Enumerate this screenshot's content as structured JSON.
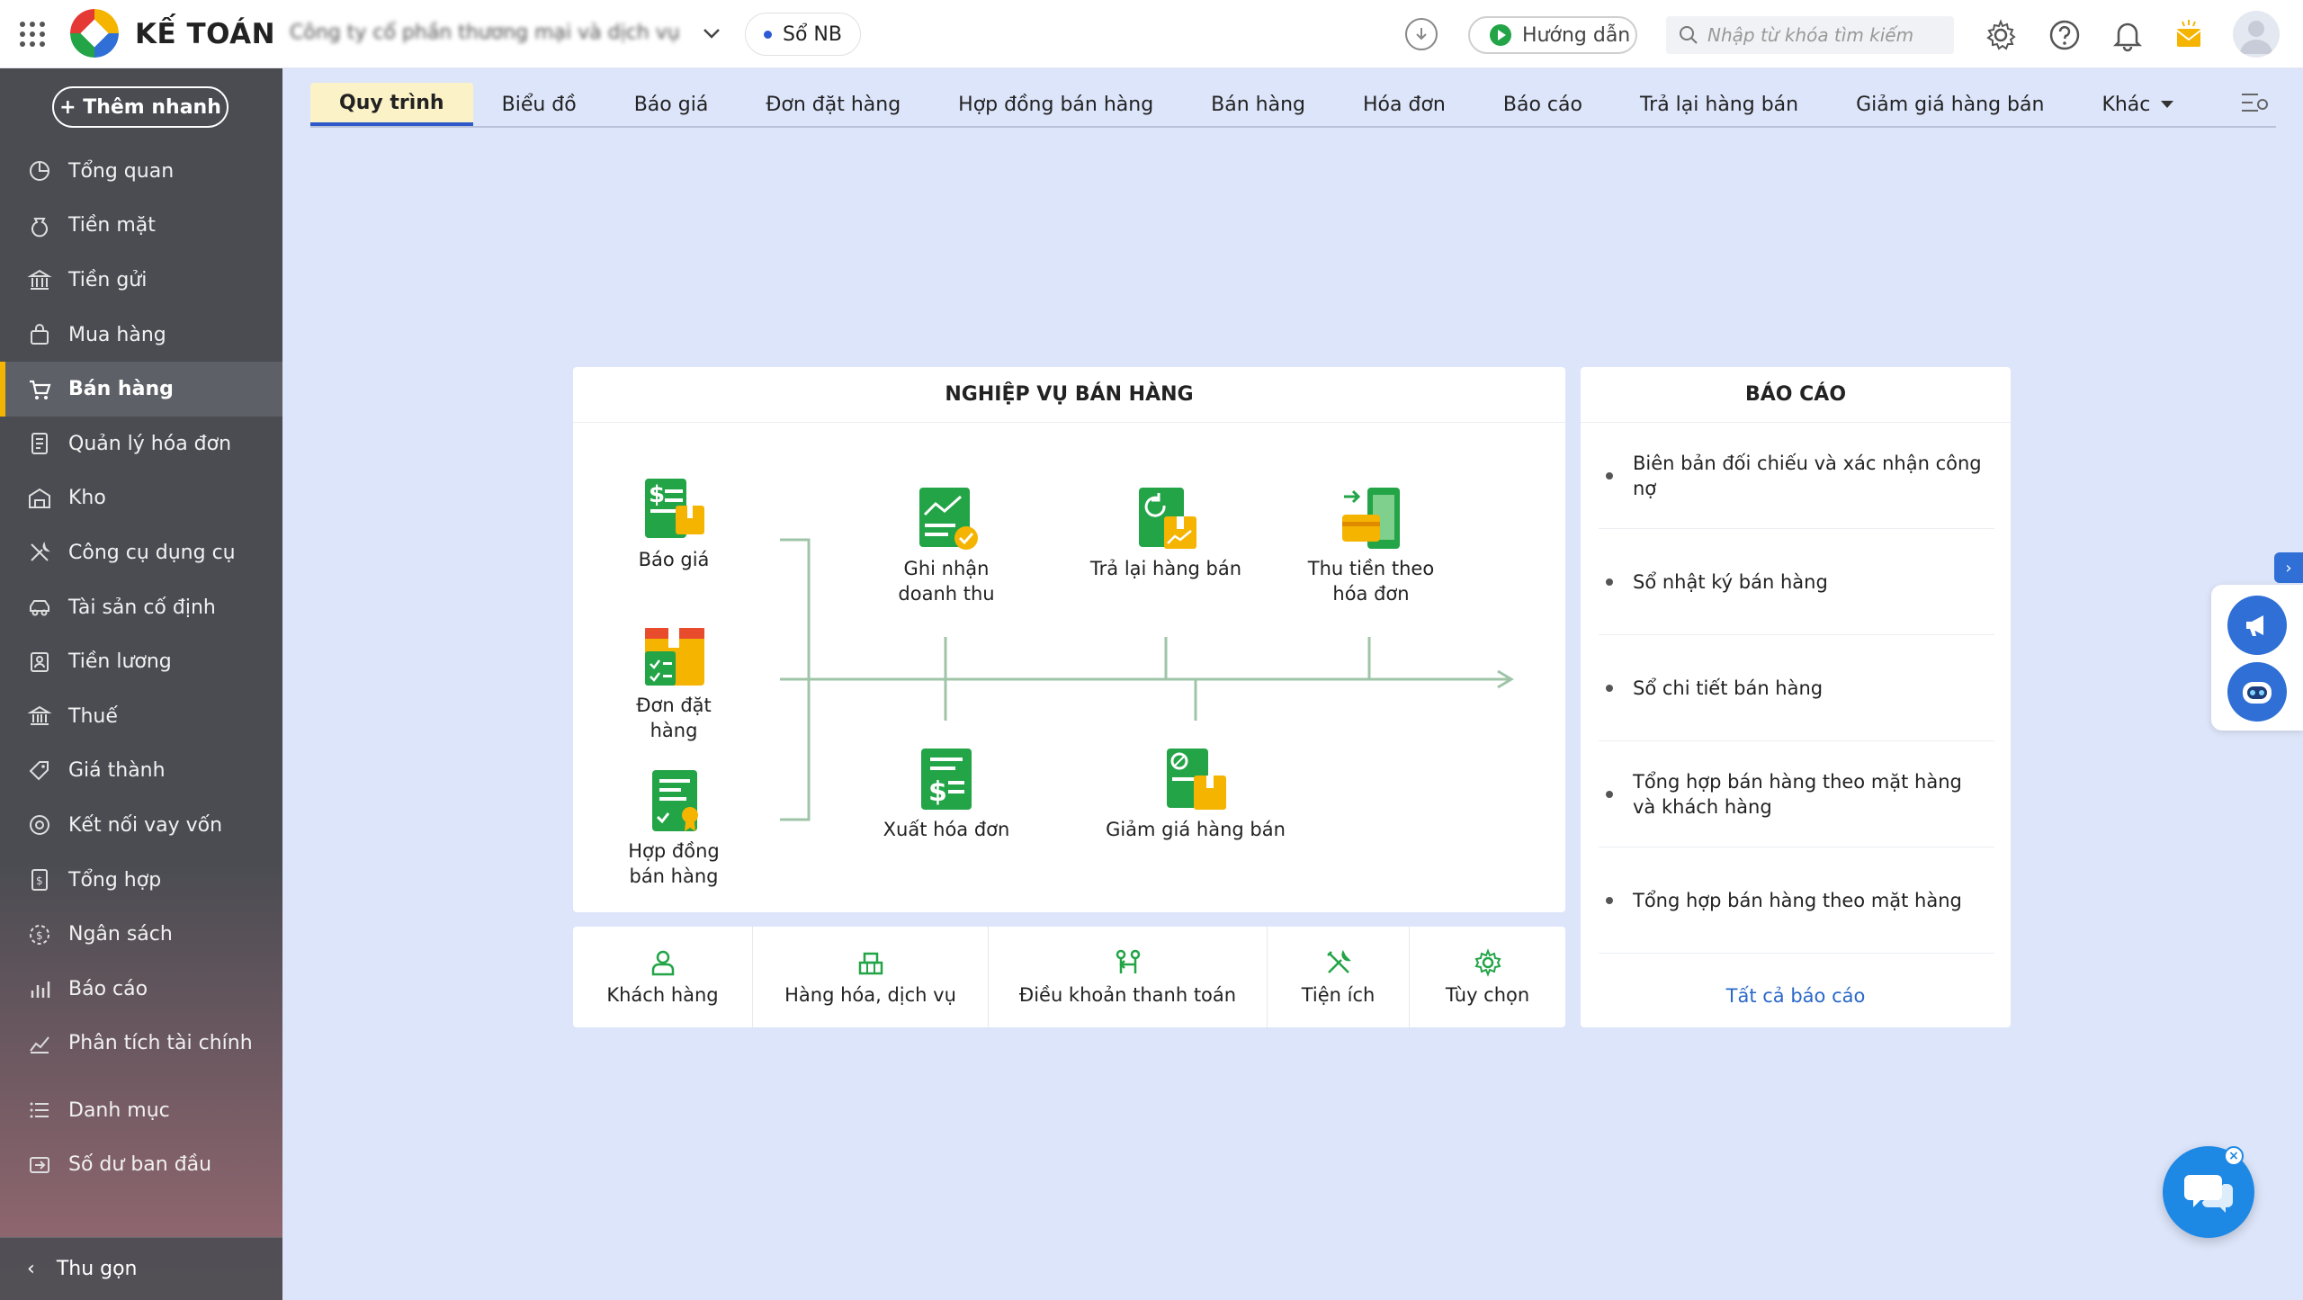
{
  "header": {
    "app_name": "KẾ TOÁN",
    "company_name": "Công ty cổ phần thương mại và dịch vụ",
    "book_label": "Sổ NB",
    "guide_label": "Hướng dẫn",
    "search_placeholder": "Nhập từ khóa tìm kiếm"
  },
  "sidebar": {
    "quick_add": "+ Thêm nhanh",
    "items": [
      {
        "label": "Tổng quan",
        "icon": "pie-chart-icon"
      },
      {
        "label": "Tiền mặt",
        "icon": "money-bag-icon"
      },
      {
        "label": "Tiền gửi",
        "icon": "bank-icon"
      },
      {
        "label": "Mua hàng",
        "icon": "shopping-bag-icon"
      },
      {
        "label": "Bán hàng",
        "icon": "cart-icon",
        "active": true
      },
      {
        "label": "Quản lý hóa đơn",
        "icon": "invoice-icon"
      },
      {
        "label": "Kho",
        "icon": "warehouse-icon"
      },
      {
        "label": "Công cụ dụng cụ",
        "icon": "tools-icon"
      },
      {
        "label": "Tài sản cố định",
        "icon": "car-icon"
      },
      {
        "label": "Tiền lương",
        "icon": "payroll-icon"
      },
      {
        "label": "Thuế",
        "icon": "tax-icon"
      },
      {
        "label": "Giá thành",
        "icon": "price-tag-icon"
      },
      {
        "label": "Kết nối vay vốn",
        "icon": "loan-icon"
      },
      {
        "label": "Tổng hợp",
        "icon": "summary-icon"
      },
      {
        "label": "Ngân sách",
        "icon": "budget-icon"
      },
      {
        "label": "Báo cáo",
        "icon": "report-icon"
      },
      {
        "label": "Phân tích tài chính",
        "icon": "analysis-icon"
      }
    ],
    "items2": [
      {
        "label": "Danh mục",
        "icon": "list-icon"
      },
      {
        "label": "Số dư ban đầu",
        "icon": "opening-balance-icon"
      }
    ],
    "collapse_label": "Thu gọn"
  },
  "tabs": [
    {
      "label": "Quy trình",
      "active": true
    },
    {
      "label": "Biểu đồ"
    },
    {
      "label": "Báo giá"
    },
    {
      "label": "Đơn đặt hàng"
    },
    {
      "label": "Hợp đồng bán hàng"
    },
    {
      "label": "Bán hàng"
    },
    {
      "label": "Hóa đơn"
    },
    {
      "label": "Báo cáo"
    },
    {
      "label": "Trả lại hàng bán"
    },
    {
      "label": "Giảm giá hàng bán"
    },
    {
      "label": "Khác",
      "dropdown": true
    }
  ],
  "process": {
    "title": "NGHIỆP VỤ BÁN HÀNG",
    "nodes": {
      "quote": "Báo giá",
      "order": "Đơn đặt hàng",
      "contract": "Hợp đồng bán hàng",
      "revenue": "Ghi nhận doanh thu",
      "returns": "Trả lại hàng bán",
      "collect": "Thu tiền theo hóa đơn",
      "invoice": "Xuất hóa đơn",
      "discount": "Giảm giá hàng bán"
    }
  },
  "utilities": [
    {
      "label": "Khách hàng",
      "icon": "customer-icon"
    },
    {
      "label": "Hàng hóa, dịch vụ",
      "icon": "goods-icon"
    },
    {
      "label": "Điều khoản thanh toán",
      "icon": "payment-terms-icon"
    },
    {
      "label": "Tiện ích",
      "icon": "utilities-icon"
    },
    {
      "label": "Tùy chọn",
      "icon": "options-gear-icon"
    }
  ],
  "reports": {
    "title": "BÁO CÁO",
    "items": [
      "Biên bản đối chiếu và xác nhận công nợ",
      "Sổ nhật ký bán hàng",
      "Sổ chi tiết bán hàng",
      "Tổng hợp bán hàng theo mặt hàng và khách hàng",
      "Tổng hợp bán hàng theo mặt hàng"
    ],
    "all_label": "Tất cả báo cáo"
  },
  "colors": {
    "accent": "#2f58c9",
    "green": "#22a447",
    "sidebar": "#4a4c52",
    "active_tab": "#fbf3c7",
    "background": "#dde5fa"
  }
}
